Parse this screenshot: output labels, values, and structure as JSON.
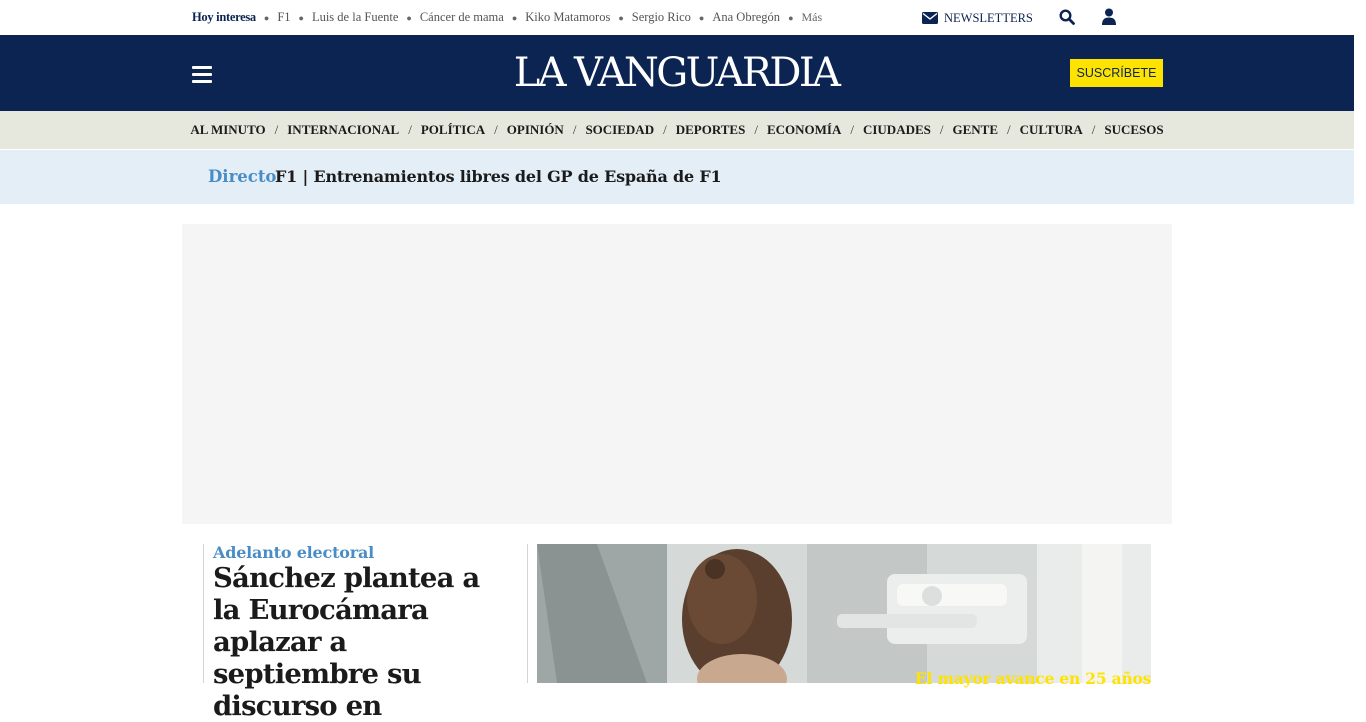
{
  "trends": {
    "lead": "Hoy interesa",
    "items": [
      "F1",
      "Luis de la Fuente",
      "Cáncer de mama",
      "Kiko Matamoros",
      "Sergio Rico",
      "Ana Obregón"
    ],
    "more": "Más"
  },
  "utility": {
    "newsletters_label": "NEWSLETTERS",
    "search_icon": "search-icon",
    "user_icon": "user-icon"
  },
  "header": {
    "logo": "LA VANGUARDIA",
    "subscribe_label": "SUSCRÍBETE",
    "menu_icon": "hamburger-icon",
    "background_color": "#0b2452",
    "subscribe_color": "#ffe300"
  },
  "sections": [
    "AL MINUTO",
    "INTERNACIONAL",
    "POLÍTICA",
    "OPINIÓN",
    "SOCIEDAD",
    "DEPORTES",
    "ECONOMÍA",
    "CIUDADES",
    "GENTE",
    "CULTURA",
    "SUCESOS"
  ],
  "live": {
    "tag": "Directo",
    "title": "F1 | Entrenamientos libres del GP de España de F1"
  },
  "story": {
    "kicker": "Adelanto electoral",
    "headline": "Sánchez plantea a la Eurocámara aplazar a septiembre su discurso en",
    "photo_caption": "El mayor avance en 25 años"
  }
}
